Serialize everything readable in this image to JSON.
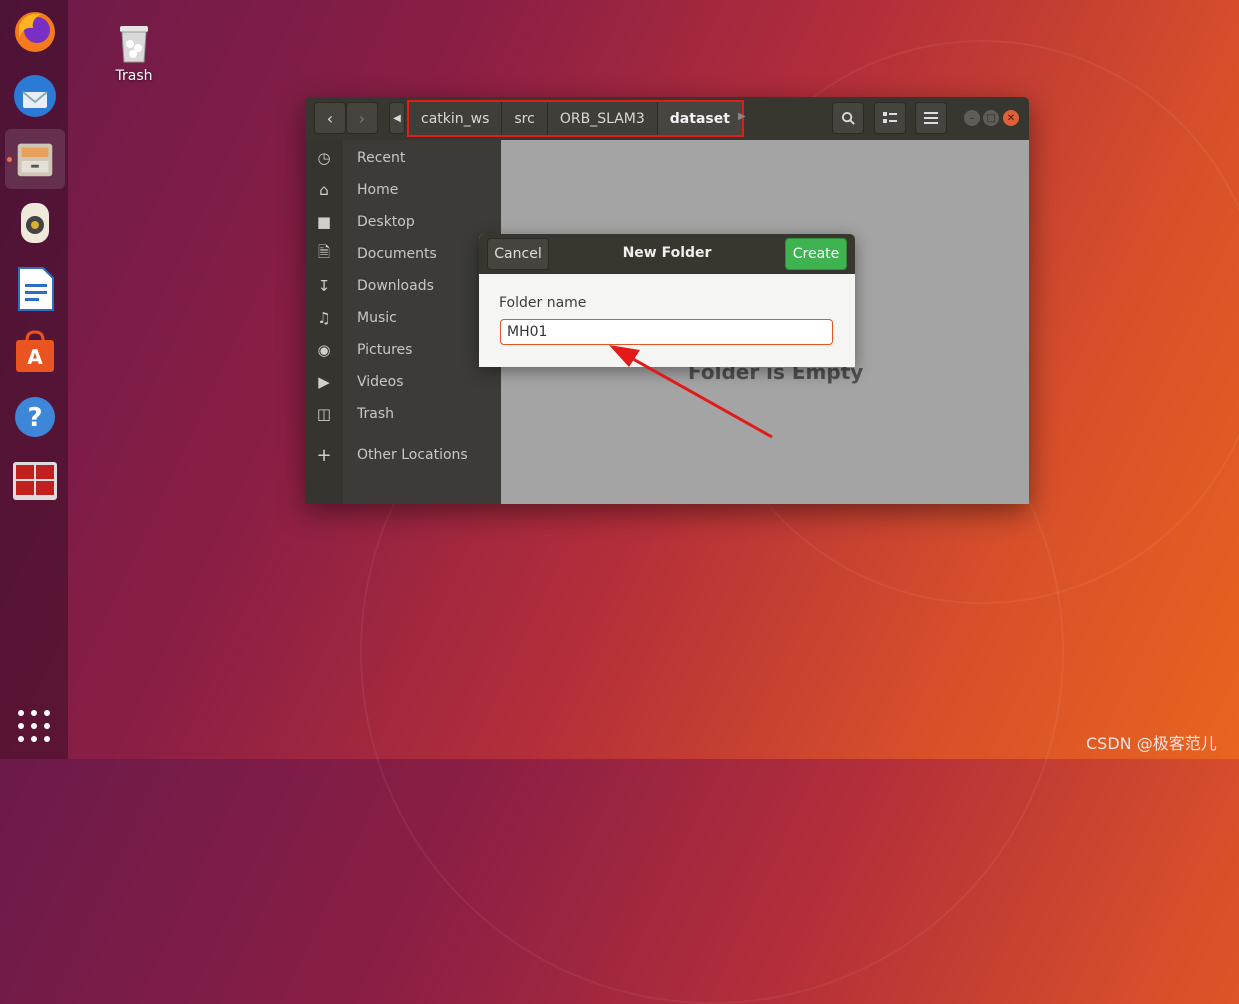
{
  "desktop": {
    "trash_label": "Trash",
    "watermark": "CSDN @极客范儿"
  },
  "dock": {
    "items": [
      "firefox-icon",
      "thunderbird-icon",
      "files-icon",
      "rhythmbox-icon",
      "libreoffice-writer-icon",
      "software-center-icon",
      "help-icon",
      "terminal-icon"
    ],
    "active": "files-icon"
  },
  "window": {
    "breadcrumbs": [
      "catkin_ws",
      "src",
      "ORB_SLAM3",
      "dataset"
    ],
    "sidebar": {
      "items": [
        {
          "label": "Recent",
          "icon": "clock-icon"
        },
        {
          "label": "Home",
          "icon": "home-icon"
        },
        {
          "label": "Desktop",
          "icon": "folder-icon"
        },
        {
          "label": "Documents",
          "icon": "document-icon"
        },
        {
          "label": "Downloads",
          "icon": "download-icon"
        },
        {
          "label": "Music",
          "icon": "music-icon"
        },
        {
          "label": "Pictures",
          "icon": "camera-icon"
        },
        {
          "label": "Videos",
          "icon": "video-icon"
        },
        {
          "label": "Trash",
          "icon": "trash-icon"
        },
        {
          "label": "Other Locations",
          "icon": "plus-icon"
        }
      ]
    },
    "content": {
      "empty_text": "Folder is Empty"
    }
  },
  "dialog": {
    "title": "New Folder",
    "cancel_label": "Cancel",
    "create_label": "Create",
    "field_label": "Folder name",
    "field_value": "MH01"
  },
  "colors": {
    "accent": "#e95420",
    "create": "#3eb34f",
    "highlight": "#e11a1a"
  }
}
